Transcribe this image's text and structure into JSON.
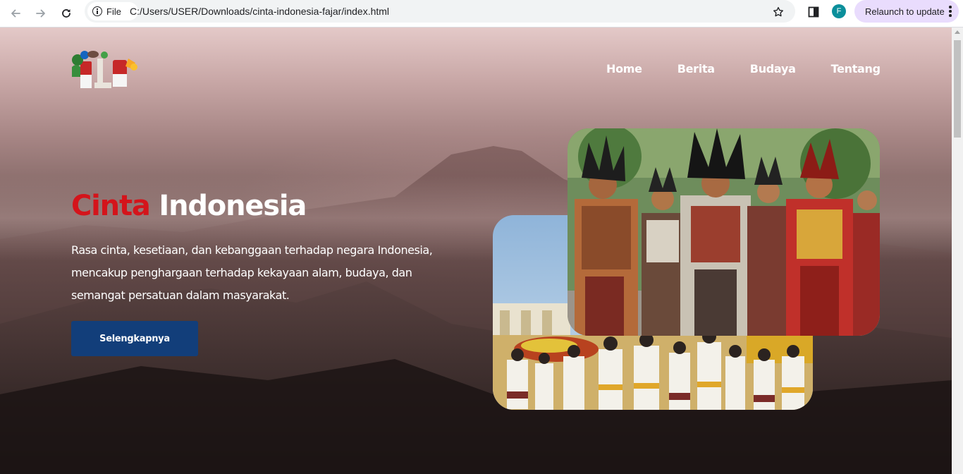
{
  "browser": {
    "site_info_label": "File",
    "url": "C:/Users/USER/Downloads/cinta-indonesia-fajar/index.html",
    "profile_initial": "F",
    "relaunch_label": "Relaunch to update",
    "icons": [
      "back-arrow-icon",
      "forward-arrow-icon",
      "reload-icon",
      "info-icon",
      "bookmark-star-icon",
      "side-panel-icon",
      "kebab-menu-icon"
    ]
  },
  "site": {
    "nav": {
      "items": [
        {
          "label": "Home"
        },
        {
          "label": "Berita"
        },
        {
          "label": "Budaya"
        },
        {
          "label": "Tentang"
        }
      ]
    },
    "hero": {
      "title_accent": "Cinta",
      "title_rest": "Indonesia",
      "description": "Rasa cinta, kesetiaan, dan kebanggaan terhadap negara Indonesia, mencakup penghargaan terhadap kekayaan alam, budaya, dan semangat persatuan dalam masyarakat.",
      "cta_label": "Selengkapnya"
    },
    "colors": {
      "accent_red": "#d4141b",
      "button_blue": "#123e7a",
      "text_white": "#ffffff"
    }
  }
}
